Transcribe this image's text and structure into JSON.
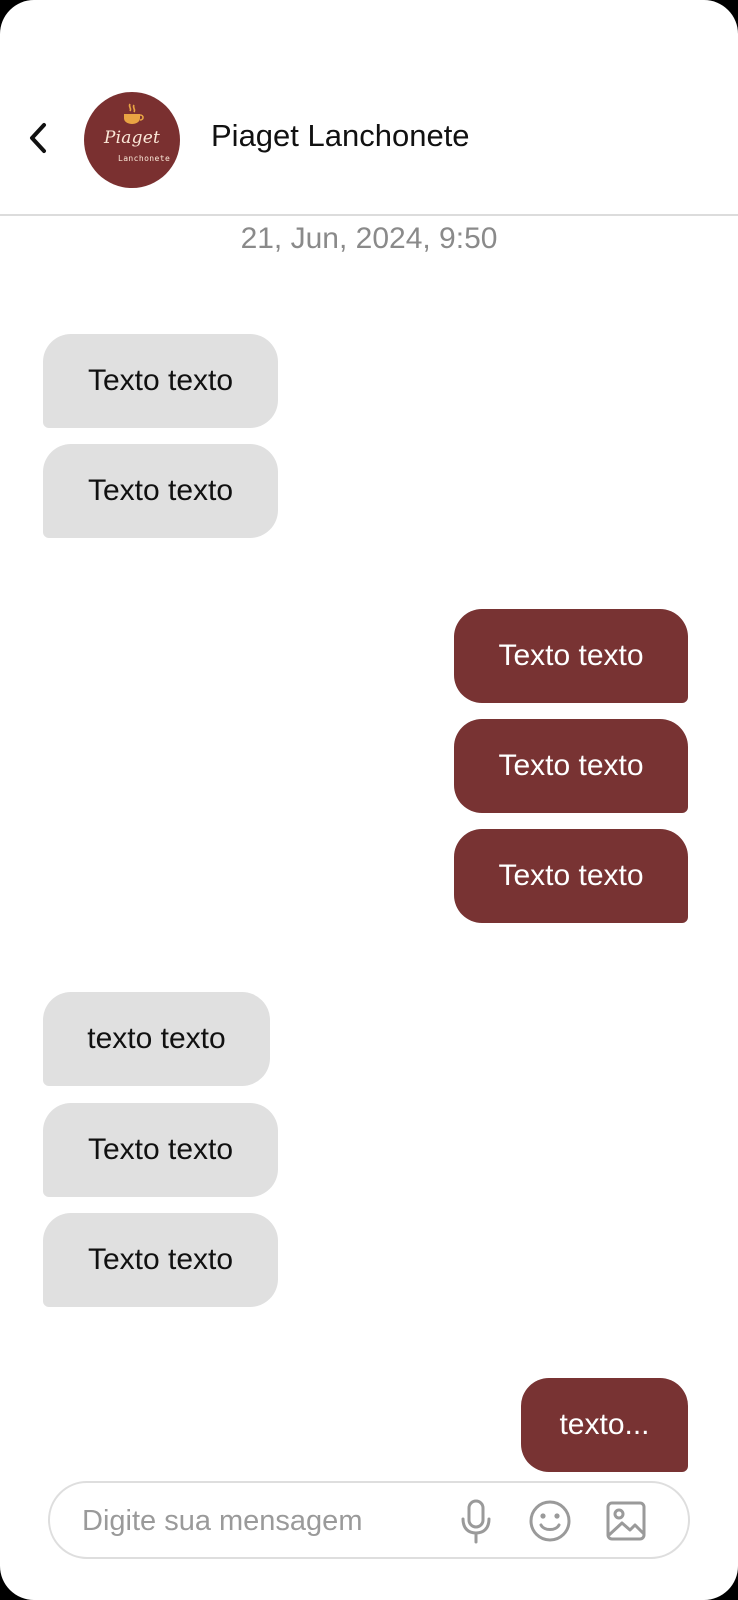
{
  "header": {
    "back_icon": "chevron-left-icon",
    "avatar": {
      "line1": "Piaget",
      "line2": "Lanchonete",
      "icon": "coffee-cup-icon"
    },
    "contact_name": "Piaget Lanchonete"
  },
  "chat": {
    "timestamp": "21, Jun, 2024, 9:50",
    "messages": [
      {
        "direction": "in",
        "text": "Texto texto"
      },
      {
        "direction": "in",
        "text": "Texto texto"
      },
      {
        "direction": "out",
        "text": "Texto texto"
      },
      {
        "direction": "out",
        "text": "Texto texto"
      },
      {
        "direction": "out",
        "text": "Texto texto"
      },
      {
        "direction": "in",
        "text": "texto texto"
      },
      {
        "direction": "in",
        "text": "Texto texto"
      },
      {
        "direction": "in",
        "text": "Texto texto"
      },
      {
        "direction": "out",
        "text": "texto..."
      }
    ]
  },
  "composer": {
    "placeholder": "Digite sua mensagem",
    "value": "",
    "icons": [
      "microphone-icon",
      "emoji-icon",
      "image-icon"
    ]
  },
  "colors": {
    "brand": "#783333",
    "incoming_bubble": "#e0e0e0",
    "timestamp": "#8a8a8a"
  }
}
